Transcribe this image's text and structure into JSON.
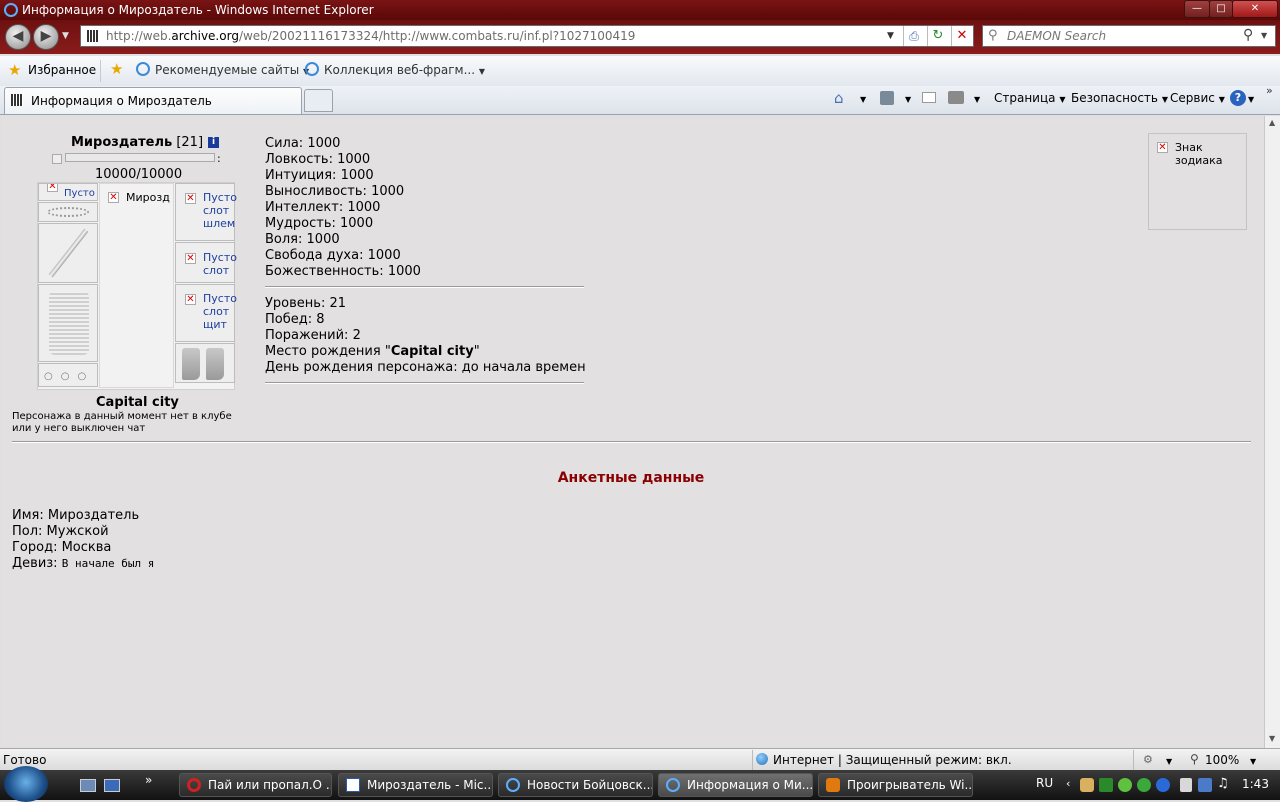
{
  "window": {
    "title": "Информация о Мироздатель - Windows Internet Explorer"
  },
  "address": {
    "url_prefix": "http://web.",
    "url_domain": "archive.org",
    "url_rest": "/web/20021116173324/http://www.combats.ru/inf.pl?1027100419"
  },
  "search": {
    "placeholder": "DAEMON Search"
  },
  "favorites": {
    "label": "Избранное",
    "items": [
      "Рекомендуемые сайты",
      "Коллекция веб-фрагм..."
    ]
  },
  "tab": {
    "label": "Информация о Мироздатель"
  },
  "commandbar": {
    "page": "Страница",
    "safety": "Безопасность",
    "tools": "Сервис"
  },
  "character": {
    "name": "Мироздатель",
    "level": "[21]",
    "hp": "10000/10000",
    "location": "Capital city",
    "status_line1": "Персонажа в данный момент нет в клубе",
    "status_line2": "или у него выключен чат",
    "avatar_alt": "Мироздатель",
    "slots": {
      "helmet": [
        "Пусто",
        "слот",
        "шлем"
      ],
      "slot2": [
        "Пусто",
        "слот"
      ],
      "shield": [
        "Пусто",
        "слот",
        "щит"
      ],
      "top_left": "Пусто"
    }
  },
  "stats": [
    {
      "label": "Сила:",
      "value": "1000"
    },
    {
      "label": "Ловкость:",
      "value": "1000"
    },
    {
      "label": "Интуиция:",
      "value": "1000"
    },
    {
      "label": "Выносливость:",
      "value": "1000"
    },
    {
      "label": "Интеллект:",
      "value": "1000"
    },
    {
      "label": "Мудрость:",
      "value": "1000"
    },
    {
      "label": "Воля:",
      "value": "1000"
    },
    {
      "label": "Свобода духа:",
      "value": "1000"
    },
    {
      "label": "Божественность:",
      "value": "1000"
    }
  ],
  "info": {
    "level": "Уровень: 21",
    "wins": "Побед: 8",
    "losses": "Поражений: 2",
    "birthplace_label": "Место рождения \"",
    "birthplace_value": "Capital city",
    "birthplace_end": "\"",
    "birthday": "День рождения персонажа: до начала времен"
  },
  "zodiac": {
    "label_line1": "Знак",
    "label_line2": "зодиака"
  },
  "profile": {
    "heading": "Анкетные данные",
    "name": "Имя: Мироздатель",
    "sex": "Пол: Мужской",
    "city": "Город: Москва",
    "motto_label": "Девиз:",
    "motto_value": "В начале был я"
  },
  "status": {
    "left": "Готово",
    "zone": "Интернет | Защищенный режим: вкл.",
    "zoom": "100%"
  },
  "taskbar": {
    "items": [
      "Пай или пропал.О ...",
      "Мироздатель - Mic...",
      "Новости Бойцовск...",
      "Информация о Ми...",
      "Проигрыватель Wi..."
    ],
    "lang": "RU",
    "time": "1:43"
  },
  "colors": {
    "title_bar": "#6e1010",
    "heading": "#8b0000",
    "content_bg": "#e2e0e0"
  }
}
